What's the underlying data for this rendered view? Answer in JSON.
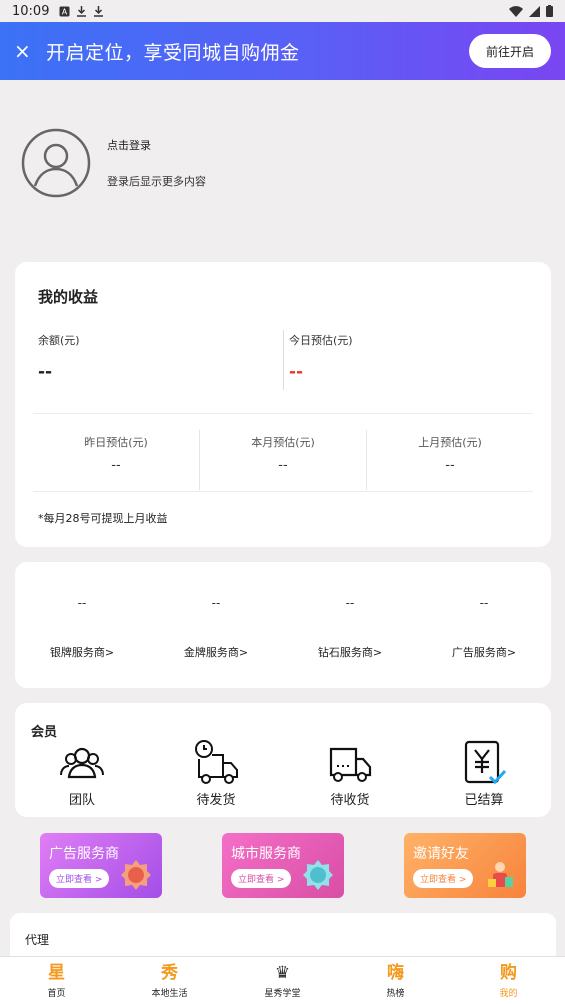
{
  "status_bar": {
    "time": "10:09"
  },
  "banner": {
    "close_label": "×",
    "text": "开启定位，享受同城自购佣金",
    "button": "前往开启"
  },
  "profile": {
    "login_label": "点击登录",
    "hint": "登录后显示更多内容"
  },
  "earnings": {
    "title": "我的收益",
    "balance": {
      "label": "余额(元)",
      "value": "--"
    },
    "today": {
      "label": "今日预估(元)",
      "value": "--"
    },
    "yesterday": {
      "label": "昨日预估(元)",
      "value": "--"
    },
    "this_month": {
      "label": "本月预估(元)",
      "value": "--"
    },
    "last_month": {
      "label": "上月预估(元)",
      "value": "--"
    },
    "note": "*每月28号可提现上月收益"
  },
  "services": [
    {
      "value": "--",
      "label": "银牌服务商>"
    },
    {
      "value": "--",
      "label": "金牌服务商>"
    },
    {
      "value": "--",
      "label": "钻石服务商>"
    },
    {
      "value": "--",
      "label": "广告服务商>"
    }
  ],
  "member": {
    "title": "会员",
    "items": [
      {
        "label": "团队",
        "icon": "team-icon"
      },
      {
        "label": "待发货",
        "icon": "truck-clock-icon"
      },
      {
        "label": "待收货",
        "icon": "truck-icon"
      },
      {
        "label": "已结算",
        "icon": "yen-doc-icon"
      }
    ]
  },
  "promos": [
    {
      "title": "广告服务商",
      "button": "立即查看 >"
    },
    {
      "title": "城市服务商",
      "button": "立即查看 >"
    },
    {
      "title": "邀请好友",
      "button": "立即查看 >"
    }
  ],
  "agent": {
    "title": "代理"
  },
  "tabbar": [
    {
      "icon_char": "星",
      "label": "首页"
    },
    {
      "icon_char": "秀",
      "label": "本地生活"
    },
    {
      "icon_char": "♛",
      "label": "星秀学堂"
    },
    {
      "icon_char": "嗨",
      "label": "热榜"
    },
    {
      "icon_char": "购",
      "label": "我的"
    }
  ],
  "colors": {
    "accent": "#f39a1e",
    "today_value": "#e53935",
    "banner_start": "#3b72f6",
    "banner_end": "#7a45f2"
  }
}
